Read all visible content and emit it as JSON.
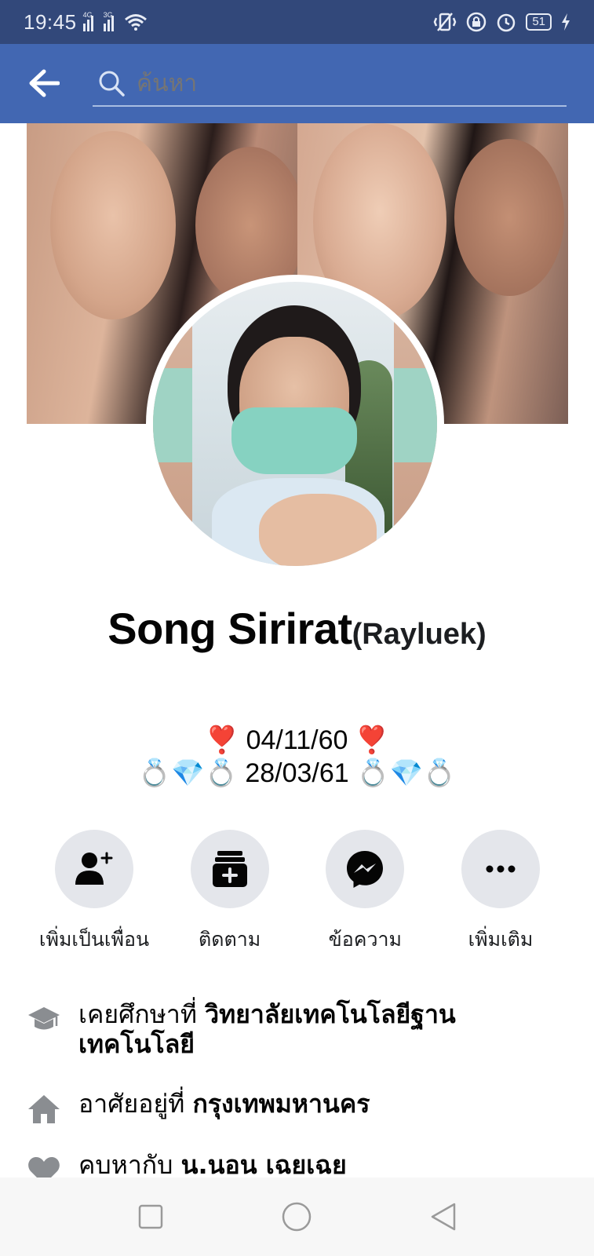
{
  "status_bar": {
    "time": "19:45",
    "signal_1_tag": "4G",
    "signal_2_tag": "3G",
    "battery": "51"
  },
  "app_bar": {
    "search_placeholder": "ค้นหา"
  },
  "profile": {
    "name": "Song Sirirat",
    "alternate_name": "(Rayluek)",
    "bio_line_1": "❣️ 04/11/60 ❣️",
    "bio_line_2": "💍💎💍 28/03/61 💍💎💍"
  },
  "actions": [
    {
      "label": "เพิ่มเป็นเพื่อน",
      "icon": "add-friend-icon"
    },
    {
      "label": "ติดตาม",
      "icon": "follow-icon"
    },
    {
      "label": "ข้อความ",
      "icon": "messenger-icon"
    },
    {
      "label": "เพิ่มเติม",
      "icon": "more-icon"
    }
  ],
  "details": {
    "education_prefix": "เคยศึกษาที่ ",
    "education_value": "วิทยาลัยเทคโนโลยีฐาน เทคโนโลยี",
    "residence_prefix": "อาศัยอยู่ที่ ",
    "residence_value": "กรุงเทพมหานคร",
    "relationship_prefix": "คบหากับ ",
    "relationship_value": "น.นอน เฉยเฉย"
  },
  "colors": {
    "status_bar": "#32487a",
    "app_bar": "#4267b2",
    "action_bg": "#e4e6eb"
  }
}
